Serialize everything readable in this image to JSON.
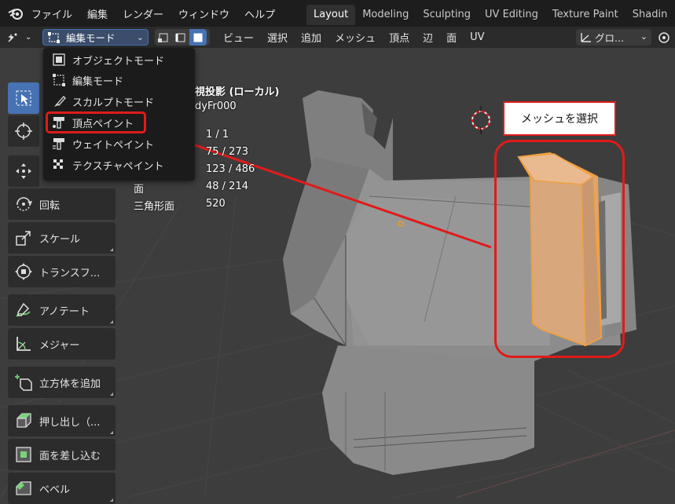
{
  "topbar": {
    "menu": [
      "ファイル",
      "編集",
      "レンダー",
      "ウィンドウ",
      "ヘルプ"
    ],
    "workspaces": [
      "Layout",
      "Modeling",
      "Sculpting",
      "UV Editing",
      "Texture Paint",
      "Shadin"
    ]
  },
  "header": {
    "mode_label": "編集モード",
    "menu": [
      "ビュー",
      "選択",
      "追加",
      "メッシュ",
      "頂点",
      "辺",
      "面",
      "UV"
    ],
    "orientation_label": "グロ..."
  },
  "mode_menu": {
    "items": [
      "オブジェクトモード",
      "編集モード",
      "スカルプトモード",
      "頂点ペイント",
      "ウェイトペイント",
      "テクスチャペイント"
    ]
  },
  "viewport_info": {
    "view_name": "視投影 (ローカル)",
    "object_name": "dyFr000",
    "objects": "1 / 1",
    "vertices": "75 / 273",
    "edges": "123 / 486",
    "faces_label": "面",
    "faces": "48 / 214",
    "triangles_label": "三角形面",
    "triangles": "520"
  },
  "tools": {
    "rotate": "回転",
    "scale": "スケール",
    "transform": "トランスフ...",
    "annotate": "アノテート",
    "measure": "メジャー",
    "add_cube": "立方体を追加",
    "extrude": "押し出し（...",
    "inset": "面を差し込む",
    "bevel": "ベベル"
  },
  "callout": {
    "text": "メッシュを選択"
  },
  "colors": {
    "accent": "#4772b3",
    "highlight_red": "#e01b1b",
    "selection_orange": "#e89a45"
  }
}
